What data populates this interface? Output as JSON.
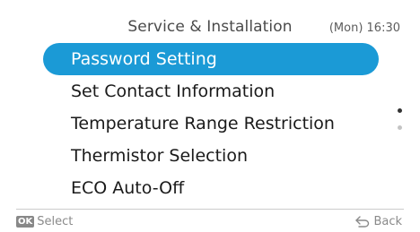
{
  "header": {
    "title": "Service & Installation",
    "clock": "(Mon) 16:30"
  },
  "menu": {
    "items": [
      {
        "label": "Password Setting",
        "selected": true
      },
      {
        "label": "Set Contact Information",
        "selected": false
      },
      {
        "label": "Temperature Range Restriction",
        "selected": false
      },
      {
        "label": "Thermistor Selection",
        "selected": false
      },
      {
        "label": "ECO Auto-Off",
        "selected": false
      }
    ]
  },
  "scroll": {
    "pages": 2,
    "current_page": 1
  },
  "footer": {
    "ok_badge": "OK",
    "select_label": "Select",
    "back_label": "Back",
    "back_icon": "return-arrow-icon"
  },
  "colors": {
    "accent": "#1b9ad6",
    "text": "#1a1a1a",
    "muted": "#8a8a8a"
  }
}
